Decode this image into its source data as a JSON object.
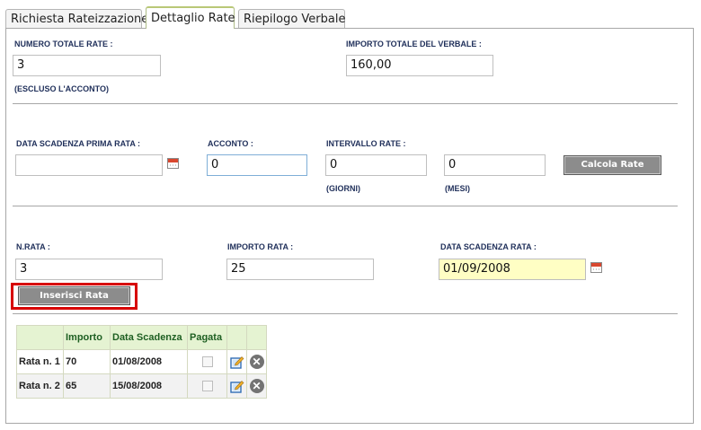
{
  "tabs": [
    {
      "label": "Richiesta Rateizzazione"
    },
    {
      "label": "Dettaglio Rate"
    },
    {
      "label": "Riepilogo Verbale"
    }
  ],
  "summary": {
    "numero_totale_rate_label": "NUMERO TOTALE RATE :",
    "numero_totale_rate_value": "3",
    "escluso_note": "(ESCLUSO L'ACCONTO)",
    "importo_totale_label": "IMPORTO TOTALE DEL VERBALE :",
    "importo_totale_value": "160,00"
  },
  "calc": {
    "data_scadenza_label": "DATA SCADENZA PRIMA RATA :",
    "data_scadenza_value": "",
    "acconto_label": "ACCONTO :",
    "acconto_value": "0",
    "intervallo_label": "INTERVALLO RATE :",
    "giorni_value": "0",
    "giorni_unit": "(GIORNI)",
    "mesi_value": "0",
    "mesi_unit": "(MESI)",
    "calcola_button": "Calcola Rate"
  },
  "insert": {
    "n_rata_label": "N.RATA :",
    "n_rata_value": "3",
    "importo_label": "IMPORTO RATA :",
    "importo_value": "25",
    "data_label": "DATA SCADENZA RATA :",
    "data_value": "01/09/2008",
    "inserisci_button": "Inserisci Rata"
  },
  "table": {
    "headers": [
      "",
      "Importo",
      "Data Scadenza",
      "Pagata",
      "",
      ""
    ],
    "rows": [
      {
        "label": "Rata n. 1",
        "importo": "70",
        "data": "01/08/2008",
        "pagata": false
      },
      {
        "label": "Rata n. 2",
        "importo": "65",
        "data": "15/08/2008",
        "pagata": false
      }
    ]
  },
  "icons": {
    "calendar": "calendar-icon",
    "edit": "edit-icon",
    "delete": "delete-icon"
  },
  "colors": {
    "label_text": "#1f2f5a",
    "table_header_bg": "#e5f3d2",
    "table_header_text": "#1e5f22",
    "highlight_border": "#d70000",
    "date_field_bg": "#fffec4",
    "button_bg": "#8c8c8c"
  }
}
